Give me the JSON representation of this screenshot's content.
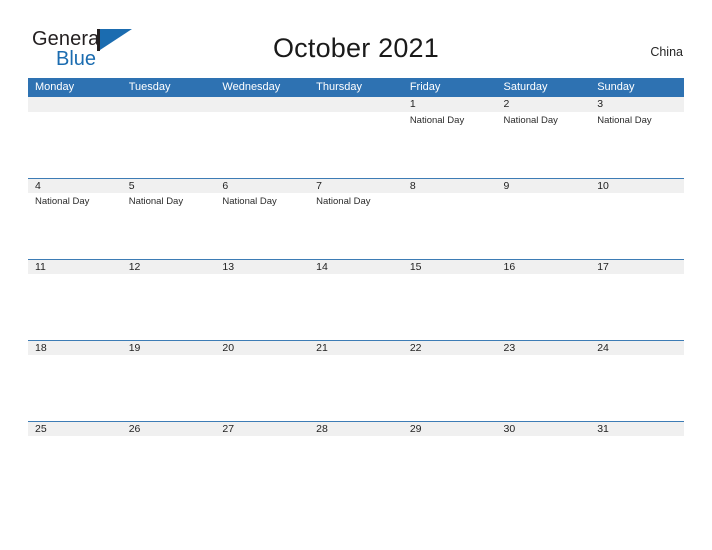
{
  "brand": {
    "name_part1": "General",
    "name_part2": "Blue",
    "color_primary": "#1b6cb0",
    "color_dark": "#231f20"
  },
  "header": {
    "title": "October 2021",
    "country": "China"
  },
  "calendar": {
    "header_bg": "#2e72b2",
    "date_strip_bg": "#f0f0f0",
    "row_rule_color": "#3d7cb5",
    "weekdays": [
      "Monday",
      "Tuesday",
      "Wednesday",
      "Thursday",
      "Friday",
      "Saturday",
      "Sunday"
    ],
    "weeks": [
      {
        "rule": false,
        "days": [
          {
            "num": "",
            "events": []
          },
          {
            "num": "",
            "events": []
          },
          {
            "num": "",
            "events": []
          },
          {
            "num": "",
            "events": []
          },
          {
            "num": "1",
            "events": [
              "National Day"
            ]
          },
          {
            "num": "2",
            "events": [
              "National Day"
            ]
          },
          {
            "num": "3",
            "events": [
              "National Day"
            ]
          }
        ]
      },
      {
        "rule": true,
        "days": [
          {
            "num": "4",
            "events": [
              "National Day"
            ]
          },
          {
            "num": "5",
            "events": [
              "National Day"
            ]
          },
          {
            "num": "6",
            "events": [
              "National Day"
            ]
          },
          {
            "num": "7",
            "events": [
              "National Day"
            ]
          },
          {
            "num": "8",
            "events": []
          },
          {
            "num": "9",
            "events": []
          },
          {
            "num": "10",
            "events": []
          }
        ]
      },
      {
        "rule": true,
        "days": [
          {
            "num": "11",
            "events": []
          },
          {
            "num": "12",
            "events": []
          },
          {
            "num": "13",
            "events": []
          },
          {
            "num": "14",
            "events": []
          },
          {
            "num": "15",
            "events": []
          },
          {
            "num": "16",
            "events": []
          },
          {
            "num": "17",
            "events": []
          }
        ]
      },
      {
        "rule": true,
        "days": [
          {
            "num": "18",
            "events": []
          },
          {
            "num": "19",
            "events": []
          },
          {
            "num": "20",
            "events": []
          },
          {
            "num": "21",
            "events": []
          },
          {
            "num": "22",
            "events": []
          },
          {
            "num": "23",
            "events": []
          },
          {
            "num": "24",
            "events": []
          }
        ]
      },
      {
        "rule": true,
        "days": [
          {
            "num": "25",
            "events": []
          },
          {
            "num": "26",
            "events": []
          },
          {
            "num": "27",
            "events": []
          },
          {
            "num": "28",
            "events": []
          },
          {
            "num": "29",
            "events": []
          },
          {
            "num": "30",
            "events": []
          },
          {
            "num": "31",
            "events": []
          }
        ]
      }
    ]
  }
}
